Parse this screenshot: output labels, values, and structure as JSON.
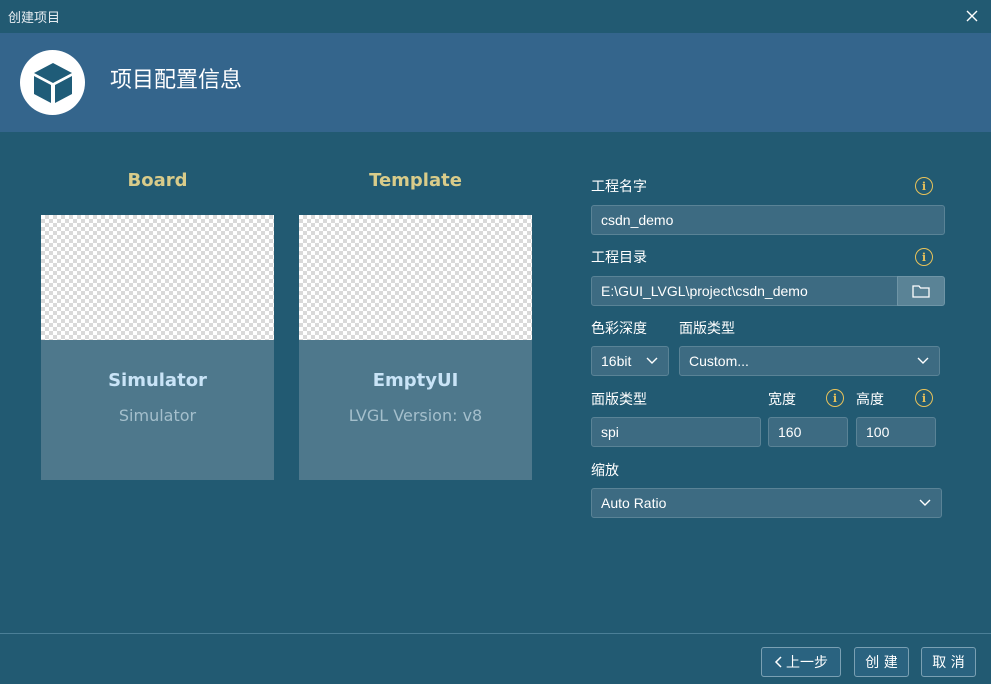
{
  "window": {
    "title": "创建项目"
  },
  "header": {
    "title": "项目配置信息"
  },
  "board": {
    "section_title": "Board",
    "card_name": "Simulator",
    "card_sub": "Simulator"
  },
  "template": {
    "section_title": "Template",
    "card_name": "EmptyUI",
    "card_sub": "LVGL Version: v8"
  },
  "form": {
    "project_name_label": "工程名字",
    "project_name_value": "csdn_demo",
    "project_dir_label": "工程目录",
    "project_dir_value": "E:\\GUI_LVGL\\project\\csdn_demo",
    "color_depth_label": "色彩深度",
    "color_depth_value": "16bit",
    "panel_type_label": "面版类型",
    "panel_type_value": "Custom...",
    "interface_label": "面版类型",
    "interface_value": "spi",
    "width_label": "宽度",
    "width_value": "160",
    "height_label": "高度",
    "height_value": "100",
    "scale_label": "缩放",
    "scale_value": "Auto Ratio"
  },
  "footer": {
    "prev_label": "上一步",
    "create_label": "创 建",
    "cancel_label": "取 消"
  },
  "colors": {
    "background": "#225a72",
    "header": "#34658c",
    "accent_title": "#d9cc8a",
    "info_icon": "#e8c25a"
  }
}
